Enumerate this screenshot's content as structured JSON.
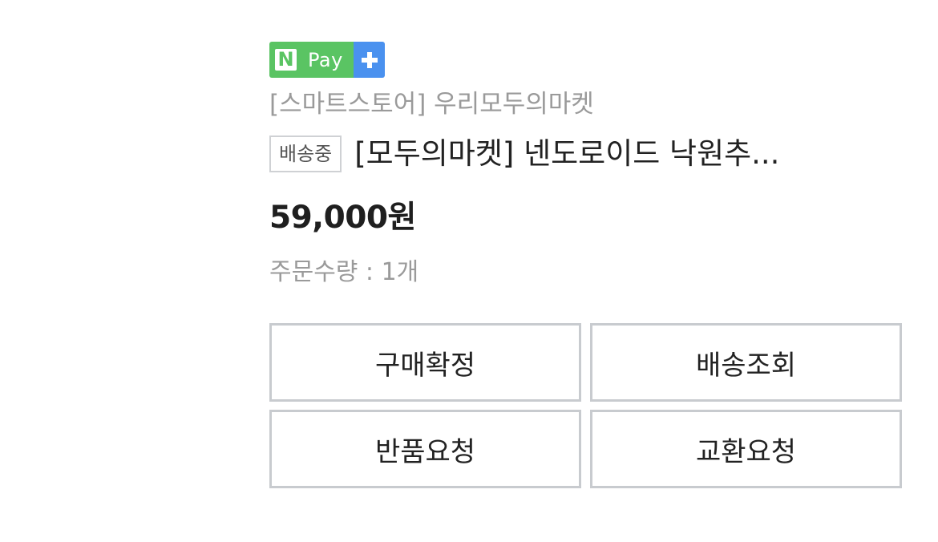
{
  "payment_badge": {
    "letter": "N",
    "label": "Pay",
    "plus_icon": "plus-icon",
    "colors": {
      "green": "#5ac463",
      "blue": "#4a91ef"
    }
  },
  "order_item": {
    "store": "[스마트스토어] 우리모두의마켓",
    "status_badge": "배송중",
    "title": "[모두의마켓] 넨도로이드 낙원추...",
    "price": "59,000원",
    "quantity": "주문수량 : 1개"
  },
  "actions": {
    "confirm_purchase": "구매확정",
    "track_delivery": "배송조회",
    "request_return": "반품요청",
    "request_exchange": "교환요청"
  }
}
